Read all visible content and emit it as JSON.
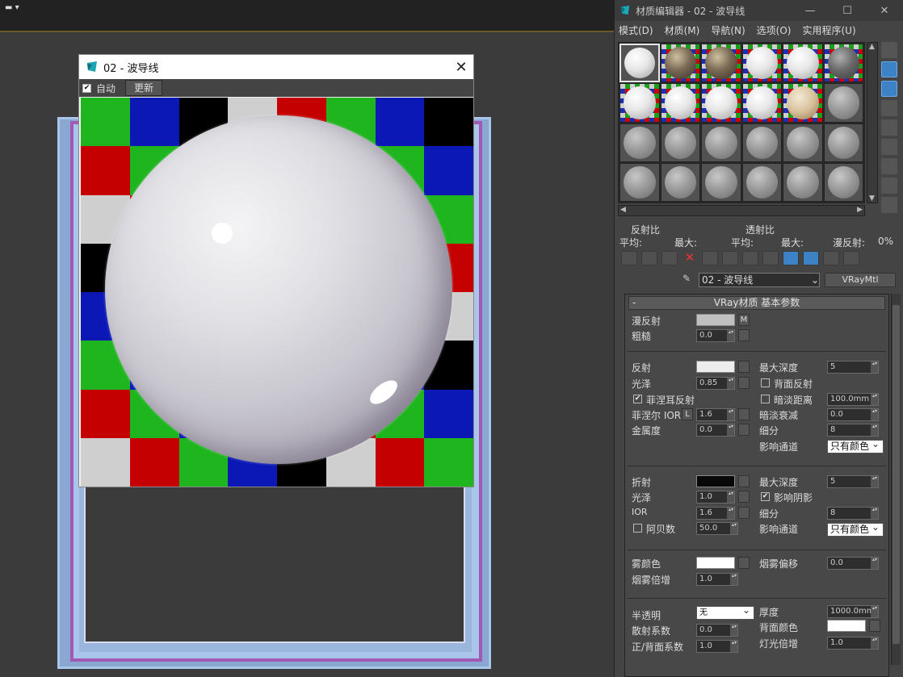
{
  "preview": {
    "title": "02 - 波导线",
    "close": "✕",
    "auto_label": "自动",
    "auto_checked": "✔",
    "update_button": "更新",
    "checker_colors": [
      [
        "#1fb51f",
        "#0b18b5",
        "#000000",
        "#cfcfcf",
        "#c40000",
        "#1fb51f",
        "#0b18b5",
        "#000000"
      ],
      [
        "#c40000",
        "#1fb51f",
        "#0b18b5",
        "#000000",
        "#cfcfcf",
        "#c40000",
        "#1fb51f",
        "#0b18b5"
      ],
      [
        "#cfcfcf",
        "#c40000",
        "#1fb51f",
        "#0b18b5",
        "#000000",
        "#cfcfcf",
        "#c40000",
        "#1fb51f"
      ],
      [
        "#000000",
        "#cfcfcf",
        "#c40000",
        "#1fb51f",
        "#0b18b5",
        "#000000",
        "#cfcfcf",
        "#c40000"
      ],
      [
        "#0b18b5",
        "#000000",
        "#cfcfcf",
        "#c40000",
        "#1fb51f",
        "#0b18b5",
        "#000000",
        "#cfcfcf"
      ],
      [
        "#1fb51f",
        "#0b18b5",
        "#000000",
        "#cfcfcf",
        "#c40000",
        "#1fb51f",
        "#0b18b5",
        "#000000"
      ],
      [
        "#c40000",
        "#1fb51f",
        "#0b18b5",
        "#000000",
        "#cfcfcf",
        "#c40000",
        "#1fb51f",
        "#0b18b5"
      ],
      [
        "#cfcfcf",
        "#c40000",
        "#1fb51f",
        "#0b18b5",
        "#000000",
        "#cfcfcf",
        "#c40000",
        "#1fb51f"
      ]
    ]
  },
  "editor": {
    "title": "材质编辑器 - 02 - 波导线",
    "minimize": "—",
    "maximize": "☐",
    "close": "✕",
    "menu": [
      "模式(D)",
      "材质(M)",
      "导航(N)",
      "选项(O)",
      "实用程序(U)"
    ],
    "slots": [
      [
        "white sel",
        "noisy checker-bg",
        "noisy checker-bg",
        "white checker-bg",
        "white checker-bg",
        "dark checker-bg"
      ],
      [
        "white checker-bg",
        "white checker-bg",
        "white checker-bg",
        "white checker-bg",
        "tan checker-bg",
        ""
      ],
      [
        "",
        "",
        "",
        "",
        "",
        ""
      ],
      [
        "",
        "",
        "",
        "",
        "",
        ""
      ]
    ],
    "reflect_ratio": "反射比",
    "refract_ratio": "透射比",
    "avg1": "平均:",
    "max1": "最大:",
    "avg2": "平均:",
    "max2": "最大:",
    "diffuse_reflect": "漫反射:",
    "diffuse_value": "0%",
    "material_name": "02 - 波导线",
    "material_type": "VRayMtl",
    "rollout_title": "VRay材质 基本参数",
    "rollout_minus": "-",
    "diffuse": {
      "label": "漫反射",
      "m": "M",
      "rough_label": "粗糙",
      "rough_value": "0.0",
      "color": "#c0c0c0"
    },
    "reflection": {
      "label": "反射",
      "color": "#ededed",
      "gloss_label": "光泽",
      "gloss_value": "0.85",
      "fresnel_label": "菲涅耳反射",
      "fresnel_checked": "✔",
      "fresnel_ior_label": "菲涅尔 IOR",
      "l_button": "L",
      "fresnel_ior_value": "1.6",
      "metal_label": "金属度",
      "metal_value": "0.0",
      "max_depth_label": "最大深度",
      "max_depth_value": "5",
      "back_reflect_label": "背面反射",
      "dim_dist_label": "暗淡距离",
      "dim_dist_value": "100.0mm",
      "dim_falloff_label": "暗淡衰减",
      "dim_falloff_value": "0.0",
      "subdiv_label": "细分",
      "subdiv_value": "8",
      "affect_label": "影响通道",
      "affect_value": "只有颜色"
    },
    "refraction": {
      "label": "折射",
      "color": "#080808",
      "gloss_label": "光泽",
      "gloss_value": "1.0",
      "ior_label": "IOR",
      "ior_value": "1.6",
      "abbe_label": "阿贝数",
      "abbe_value": "50.0",
      "max_depth_label": "最大深度",
      "max_depth_value": "5",
      "affect_shadow_label": "影响阴影",
      "affect_shadow_checked": "✔",
      "subdiv_label": "细分",
      "subdiv_value": "8",
      "affect_label": "影响通道",
      "affect_value": "只有颜色"
    },
    "fog": {
      "color_label": "雾颜色",
      "color": "#ffffff",
      "mult_label": "烟雾倍增",
      "mult_value": "1.0",
      "bias_label": "烟雾偏移",
      "bias_value": "0.0"
    },
    "translucency": {
      "label": "半透明",
      "value": "无",
      "scatter_label": "散射系数",
      "scatter_value": "0.0",
      "fb_label": "正/背面系数",
      "fb_value": "1.0",
      "thickness_label": "厚度",
      "thickness_value": "1000.0mm",
      "back_color_label": "背面颜色",
      "back_color": "#ffffff",
      "light_mult_label": "灯光倍增",
      "light_mult_value": "1.0"
    }
  }
}
